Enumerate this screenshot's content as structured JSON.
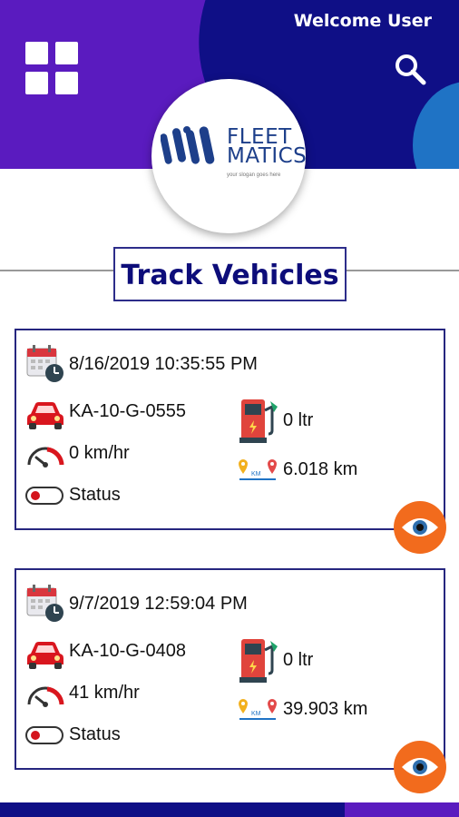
{
  "header": {
    "welcome_text": "Welcome User",
    "menu_icon": "grid-menu-icon",
    "search_icon": "search-icon",
    "colors": {
      "purple": "#5a1bbf",
      "navy": "#0f0f86",
      "accent_blue": "#1f73c5"
    }
  },
  "logo": {
    "line1": "FLEET",
    "line2": "MATICS",
    "slogan": "your slogan goes here"
  },
  "page_title": "Track Vehicles",
  "vehicles": [
    {
      "datetime": "8/16/2019 10:35:55 PM",
      "plate": "KA-10-G-0555",
      "speed": "0 km/hr",
      "status_label": "Status",
      "fuel": "0 ltr",
      "distance": "6.018 km",
      "distance_label": "KM"
    },
    {
      "datetime": "9/7/2019 12:59:04 PM",
      "plate": "KA-10-G-0408",
      "speed": "41 km/hr",
      "status_label": "Status",
      "fuel": "0 ltr",
      "distance": "39.903 km",
      "distance_label": "KM"
    }
  ],
  "icons": [
    "calendar-clock-icon",
    "car-icon",
    "speedometer-icon",
    "status-toggle",
    "fuel-pump-icon",
    "distance-pin-icon",
    "view-eye-icon"
  ],
  "accent_orange": "#f26b1d"
}
